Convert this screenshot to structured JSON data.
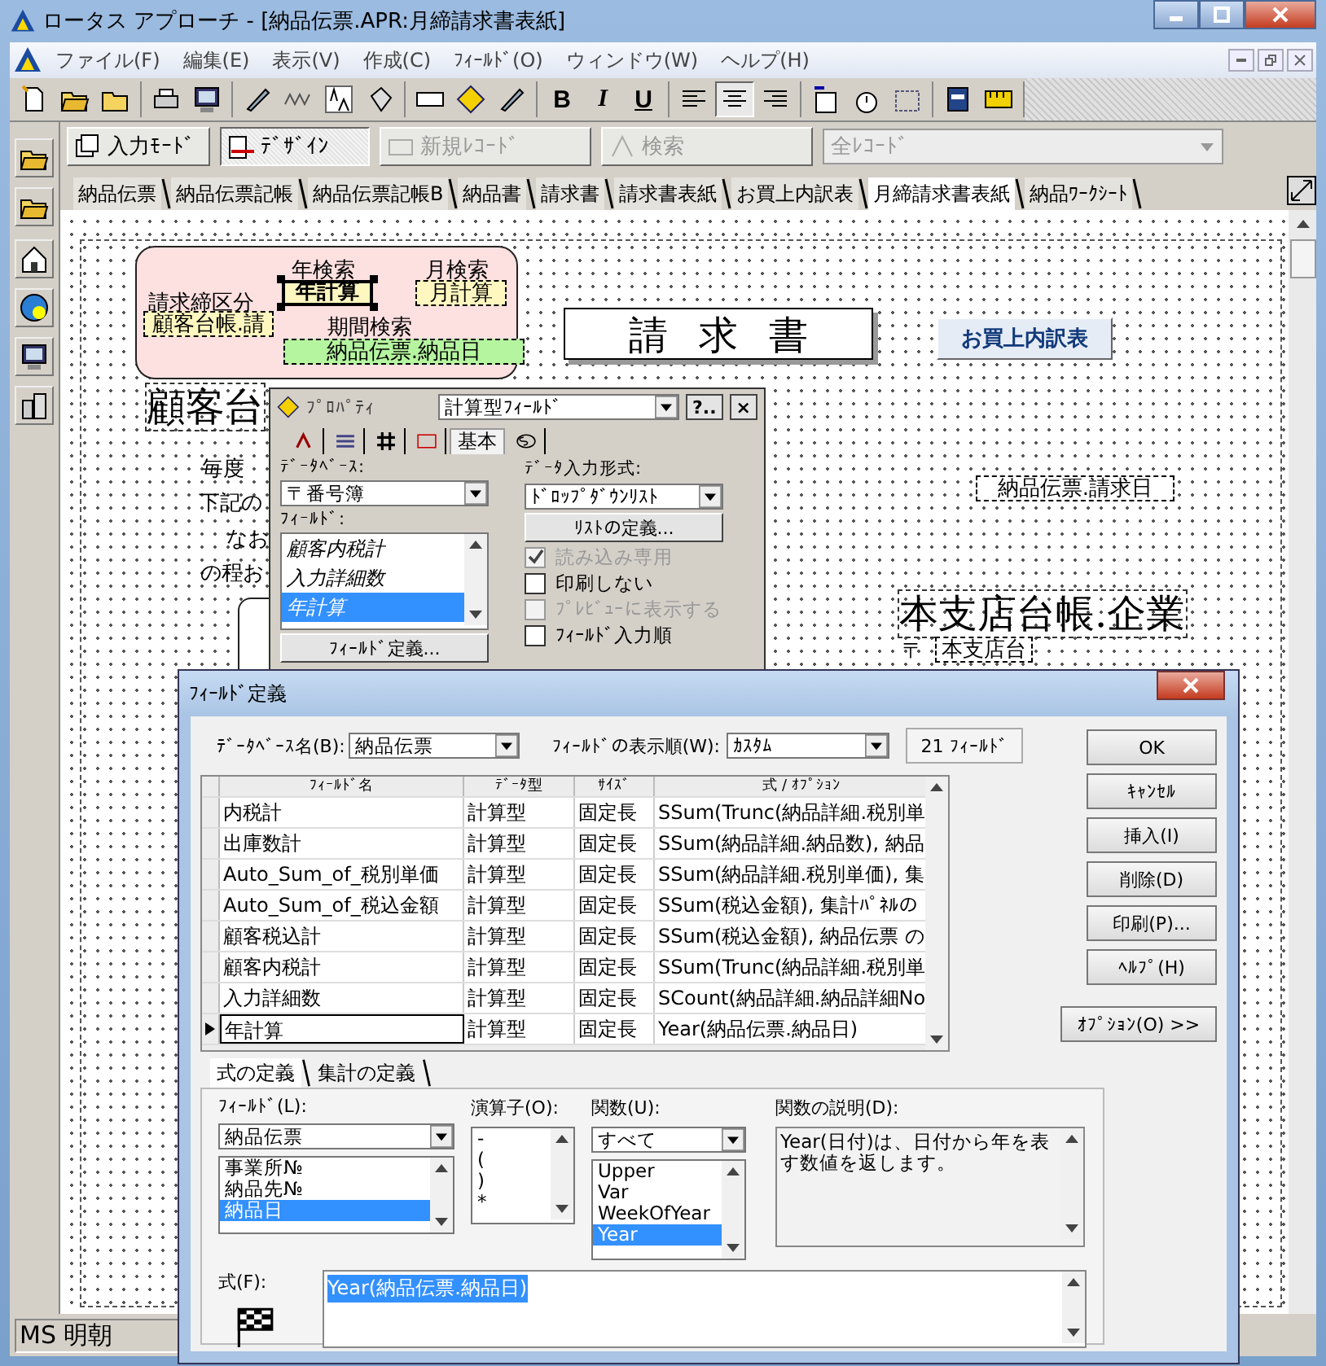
{
  "window": {
    "title": "ロータス アプローチ - [納品伝票.APR:月締請求書表紙]"
  },
  "menu": [
    "ファイル(F)",
    "編集(E)",
    "表示(V)",
    "作成(C)",
    "ﾌｨｰﾙﾄﾞ(O)",
    "ウィンドウ(W)",
    "ヘルプ(H)"
  ],
  "toolbar": {
    "format_buttons": [
      "B",
      "I",
      "U"
    ],
    "align_buttons": [
      {
        "selected": false
      },
      {
        "selected": true
      },
      {
        "selected": false
      }
    ]
  },
  "mode_bar": {
    "buttons": [
      {
        "label": "入力ﾓｰﾄﾞ",
        "selected": false,
        "disabled": false
      },
      {
        "label": "ﾃﾞｻﾞｲﾝ",
        "selected": true,
        "disabled": false
      },
      {
        "label": "新規ﾚｺｰﾄﾞ",
        "selected": false,
        "disabled": true
      },
      {
        "label": "検索",
        "selected": false,
        "disabled": true
      }
    ],
    "view_select": {
      "value": "全ﾚｺｰﾄﾞ",
      "disabled": true
    }
  },
  "tabs": [
    {
      "label": "納品伝票",
      "selected": false
    },
    {
      "label": "納品伝票記帳",
      "selected": false
    },
    {
      "label": "納品伝票記帳B",
      "selected": false
    },
    {
      "label": "納品書",
      "selected": false
    },
    {
      "label": "請求書",
      "selected": false
    },
    {
      "label": "請求書表紙",
      "selected": false
    },
    {
      "label": "お買上内訳表",
      "selected": false
    },
    {
      "label": "月締請求書表紙",
      "selected": true
    },
    {
      "label": "納品ﾜｰｸｼｰﾄ",
      "selected": false
    }
  ],
  "canvas": {
    "items": [
      {
        "kind": "label",
        "text": "請求締区分"
      },
      {
        "kind": "field",
        "text": "顧客台帳.請",
        "color": "#fff7c0",
        "selected": false
      },
      {
        "kind": "label",
        "text": "年検索"
      },
      {
        "kind": "field",
        "text": "年計算",
        "color": "#fff7c0",
        "selected": true
      },
      {
        "kind": "label",
        "text": "月検索"
      },
      {
        "kind": "field",
        "text": "月計算",
        "color": "#fff7c0",
        "selected": false
      },
      {
        "kind": "label",
        "text": "期間検索"
      },
      {
        "kind": "field",
        "text": "納品伝票.納品日",
        "color": "#b6f5a0",
        "selected": false
      },
      {
        "kind": "heading",
        "text": "請求書"
      },
      {
        "kind": "button",
        "text": "お買上内訳表"
      },
      {
        "kind": "big",
        "text": "顧客台"
      },
      {
        "kind": "label",
        "text": "毎度"
      },
      {
        "kind": "label",
        "text": "下記の"
      },
      {
        "kind": "label",
        "text": "なお"
      },
      {
        "kind": "label",
        "text": "の程お"
      },
      {
        "kind": "field",
        "text": "納品伝票.請求日",
        "color": "#ffffff",
        "selected": false
      },
      {
        "kind": "big",
        "text": "本支店台帳.企業"
      },
      {
        "kind": "label",
        "text": "〒"
      },
      {
        "kind": "field",
        "text": "本支店台",
        "color": "#ffffff",
        "selected": false
      }
    ]
  },
  "property_panel": {
    "title": "ﾌﾟﾛﾊﾟﾃｨ",
    "object_type": "計算型ﾌｨｰﾙﾄﾞ",
    "help_button": "?..",
    "close_button": "×",
    "tabs": [
      {
        "kind": "icon",
        "selected": false
      },
      {
        "kind": "icon",
        "selected": false
      },
      {
        "kind": "icon",
        "selected": false
      },
      {
        "kind": "icon",
        "selected": false
      },
      {
        "kind": "text",
        "label": "基本",
        "selected": true
      },
      {
        "kind": "icon",
        "selected": false
      }
    ],
    "database_label": "ﾃﾞｰﾀﾍﾞｰｽ:",
    "database": "〒番号簿",
    "field_label": "ﾌｨｰﾙﾄﾞ:",
    "fields": [
      {
        "name": "顧客内税計",
        "selected": false
      },
      {
        "name": "入力詳細数",
        "selected": false
      },
      {
        "name": "年計算",
        "selected": true
      }
    ],
    "define_field_button": "ﾌｨｰﾙﾄﾞ定義...",
    "input_format_label": "ﾃﾞｰﾀ入力形式:",
    "input_format": "ﾄﾞﾛｯﾌﾟﾀﾞｳﾝﾘｽﾄ",
    "define_list_button": "ﾘｽﾄの定義...",
    "options": [
      {
        "label": "読み込み専用",
        "checked": true,
        "disabled": true
      },
      {
        "label": "印刷しない",
        "checked": false,
        "disabled": false
      },
      {
        "label": "ﾌﾟﾚﾋﾞｭｰに表示する",
        "checked": false,
        "disabled": true
      },
      {
        "label": "ﾌｨｰﾙﾄﾞ入力順",
        "checked": false,
        "disabled": false
      }
    ]
  },
  "field_dialog": {
    "title": "ﾌｨｰﾙﾄﾞ定義",
    "database_label": "ﾃﾞｰﾀﾍﾞｰｽ名(B):",
    "database": "納品伝票",
    "order_label": "ﾌｨｰﾙﾄﾞの表示順(W):",
    "order": "ｶｽﾀﾑ",
    "field_count": "21 ﾌｨｰﾙﾄﾞ",
    "columns": [
      "ﾌｨｰﾙﾄﾞ名",
      "ﾃﾞｰﾀ型",
      "ｻｲｽﾞ",
      "式 / ｵﾌﾟｼｮﾝ"
    ],
    "rows": [
      {
        "cells": [
          "内税計",
          "計算型",
          "固定長",
          "SSum(Trunc(納品詳細.税別単"
        ],
        "selected": false
      },
      {
        "cells": [
          "出庫数計",
          "計算型",
          "固定長",
          "SSum(納品詳細.納品数), 納品"
        ],
        "selected": false
      },
      {
        "cells": [
          "Auto_Sum_of_税別単価",
          "計算型",
          "固定長",
          "SSum(納品詳細.税別単価), 集"
        ],
        "selected": false
      },
      {
        "cells": [
          "Auto_Sum_of_税込金額",
          "計算型",
          "固定長",
          "SSum(税込金額), 集計ﾊﾟﾈﾙの"
        ],
        "selected": false
      },
      {
        "cells": [
          "顧客税込計",
          "計算型",
          "固定長",
          "SSum(税込金額), 納品伝票 の"
        ],
        "selected": false
      },
      {
        "cells": [
          "顧客内税計",
          "計算型",
          "固定長",
          "SSum(Trunc(納品詳細.税別単"
        ],
        "selected": false
      },
      {
        "cells": [
          "入力詳細数",
          "計算型",
          "固定長",
          "SCount(納品詳細.納品詳細No"
        ],
        "selected": false
      },
      {
        "cells": [
          "年計算",
          "計算型",
          "固定長",
          "Year(納品伝票.納品日)"
        ],
        "selected": true
      }
    ],
    "buttons": [
      "OK",
      "ｷｬﾝｾﾙ",
      "挿入(I)",
      "削除(D)",
      "印刷(P)...",
      "ﾍﾙﾌﾟ(H)"
    ],
    "options_button": "ｵﾌﾟｼｮﾝ(O) >>",
    "tabs": [
      {
        "label": "式の定義",
        "selected": true
      },
      {
        "label": "集計の定義",
        "selected": false
      }
    ],
    "field_label": "ﾌｨｰﾙﾄﾞ(L):",
    "field_db": "納品伝票",
    "field_list": [
      {
        "name": "事業所№",
        "selected": false
      },
      {
        "name": "納品先№",
        "selected": false
      },
      {
        "name": "納品日",
        "selected": true
      }
    ],
    "operator_label": "演算子(O):",
    "operators": [
      "-",
      "(",
      ")",
      "*"
    ],
    "function_label": "関数(U):",
    "function_filter": "すべて",
    "functions": [
      {
        "name": "Upper",
        "selected": false
      },
      {
        "name": "Var",
        "selected": false
      },
      {
        "name": "WeekOfYear",
        "selected": false
      },
      {
        "name": "Year",
        "selected": true
      }
    ],
    "description_label": "関数の説明(D):",
    "description": "Year(日付)は、日付から年を表す数値を返します。",
    "formula_label": "式(F):",
    "formula": "Year(納品伝票.納品日)"
  },
  "status_bar": {
    "font": "MS 明朝"
  }
}
